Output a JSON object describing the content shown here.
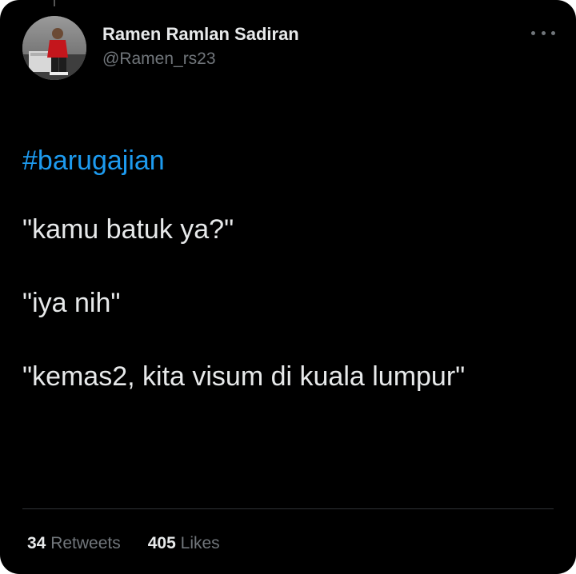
{
  "tweet": {
    "author": {
      "display_name": "Ramen Ramlan Sadiran",
      "handle": "@Ramen_rs23"
    },
    "hashtag": "#barugajian",
    "lines": [
      "\"kamu batuk ya?\"",
      "\"iya nih\"",
      "\"kemas2, kita visum di kuala lumpur\""
    ],
    "stats": {
      "retweets_count": "34",
      "retweets_label": "Retweets",
      "likes_count": "405",
      "likes_label": "Likes"
    }
  },
  "icons": {
    "more": "more-horizontal-icon"
  },
  "colors": {
    "background": "#000000",
    "text": "#e7e9ea",
    "muted": "#71767b",
    "link": "#1d9bf0",
    "divider": "#2f3336"
  }
}
